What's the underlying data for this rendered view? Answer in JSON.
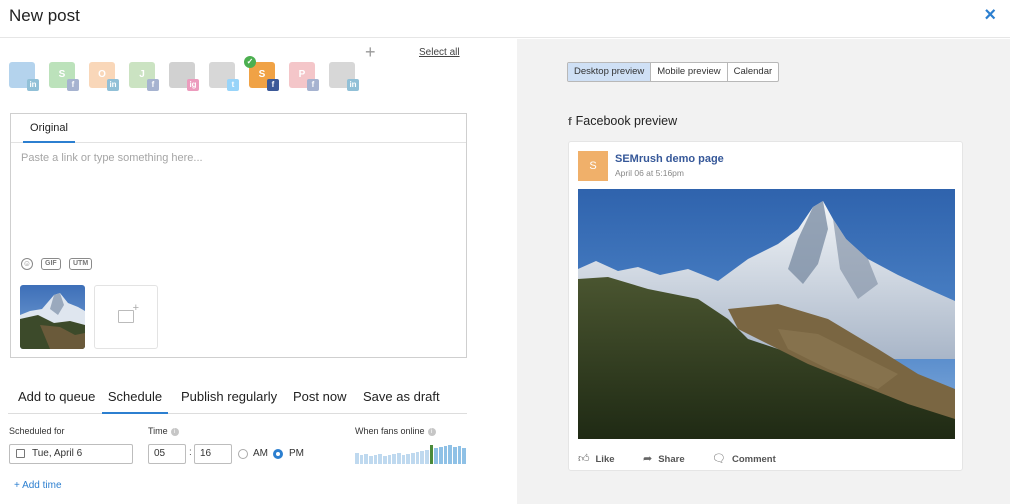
{
  "header": {
    "title": "New post",
    "close_icon": "×"
  },
  "accounts": [
    {
      "letter": "",
      "color": "#5aa0d8",
      "network": "in",
      "network_color": "#0e76a8",
      "icon": "brush-icon",
      "selected": false
    },
    {
      "letter": "S",
      "color": "#6cbf6a",
      "network": "f",
      "network_color": "#3b5998",
      "icon": "avatar",
      "selected": false
    },
    {
      "letter": "O",
      "color": "#f3a765",
      "network": "in",
      "network_color": "#0e76a8",
      "icon": "avatar",
      "selected": false
    },
    {
      "letter": "J",
      "color": "#8dc27a",
      "network": "f",
      "network_color": "#3b5998",
      "icon": "avatar",
      "selected": false
    },
    {
      "letter": "",
      "color": "#9a9a9a",
      "network": "ig",
      "network_color": "#d6246e",
      "icon": "portrait",
      "selected": false
    },
    {
      "letter": "",
      "color": "#a8a8a8",
      "network": "t",
      "network_color": "#1da1f2",
      "icon": "person-icon",
      "selected": false
    },
    {
      "letter": "S",
      "color": "#f0a245",
      "network": "f",
      "network_color": "#3b5998",
      "icon": "avatar",
      "selected": true
    },
    {
      "letter": "P",
      "color": "#e7838a",
      "network": "f",
      "network_color": "#3b5998",
      "icon": "avatar",
      "selected": false
    },
    {
      "letter": "",
      "color": "#a8a8a8",
      "network": "in",
      "network_color": "#0e76a8",
      "icon": "person-icon",
      "selected": false
    }
  ],
  "select_all": "Select all",
  "editor": {
    "tab": "Original",
    "placeholder": "Paste a link or type something here...",
    "gif": "GIF",
    "utm": "UTM"
  },
  "schedule_tabs": [
    "Add to queue",
    "Schedule",
    "Publish regularly",
    "Post now",
    "Save as draft"
  ],
  "active_schedule_tab": "Schedule",
  "schedule": {
    "scheduled_for_label": "Scheduled for",
    "date": "Tue, April 6",
    "time_label": "Time",
    "hour": "05",
    "minute": "16",
    "am": "AM",
    "pm": "PM",
    "selected_period": "PM",
    "fans_label": "When fans online",
    "fans_levels": [
      0.55,
      0.45,
      0.5,
      0.4,
      0.45,
      0.5,
      0.4,
      0.45,
      0.5,
      0.55,
      0.45,
      0.5,
      0.55,
      0.6,
      0.65,
      0.7,
      0.95,
      0.8,
      0.85,
      0.9,
      0.95,
      0.85,
      0.9,
      0.8
    ],
    "fans_highlight_index": 16,
    "add_time": "Add time"
  },
  "preview": {
    "tabs": [
      "Desktop preview",
      "Mobile preview",
      "Calendar"
    ],
    "active_tab": "Desktop preview",
    "title": "Facebook preview",
    "page_name": "SEMrush demo page",
    "avatar_letter": "S",
    "post_date": "April 06 at 5:16pm",
    "like": "Like",
    "share": "Share",
    "comment": "Comment"
  },
  "colors": {
    "accent": "#2c7fd0",
    "facebook_blue": "#365899"
  }
}
